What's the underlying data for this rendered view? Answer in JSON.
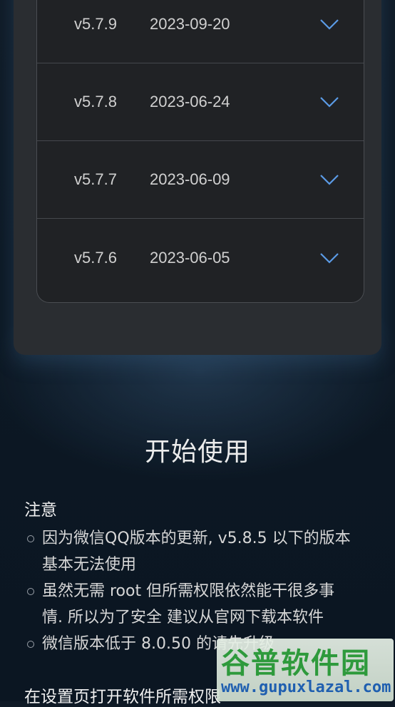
{
  "versions": [
    {
      "version": "v5.7.9",
      "date": "2023-09-20"
    },
    {
      "version": "v5.7.8",
      "date": "2023-06-24"
    },
    {
      "version": "v5.7.7",
      "date": "2023-06-09"
    },
    {
      "version": "v5.7.6",
      "date": "2023-06-05"
    }
  ],
  "getting_started": {
    "title": "开始使用",
    "notice_heading": "注意",
    "notes": [
      {
        "line1": "因为微信QQ版本的更新, v5.8.5 以下的版本",
        "line2": "基本无法使用"
      },
      {
        "line1": "虽然无需 root 但所需权限依然能干很多事",
        "line2": "情. 所以为了安全 建议从官网下载本软件"
      },
      {
        "line1": "微信版本低于 8.0.50 的请先升级",
        "line2": ""
      }
    ],
    "next_heading": "在设置页打开软件所需权限"
  },
  "watermark": {
    "logo_text": "谷普软件园",
    "url": "www.gupuxlazal.com"
  },
  "colors": {
    "accent_chevron": "#5b9be6",
    "card_bg": "#2a2d31",
    "table_bg": "#202225"
  }
}
